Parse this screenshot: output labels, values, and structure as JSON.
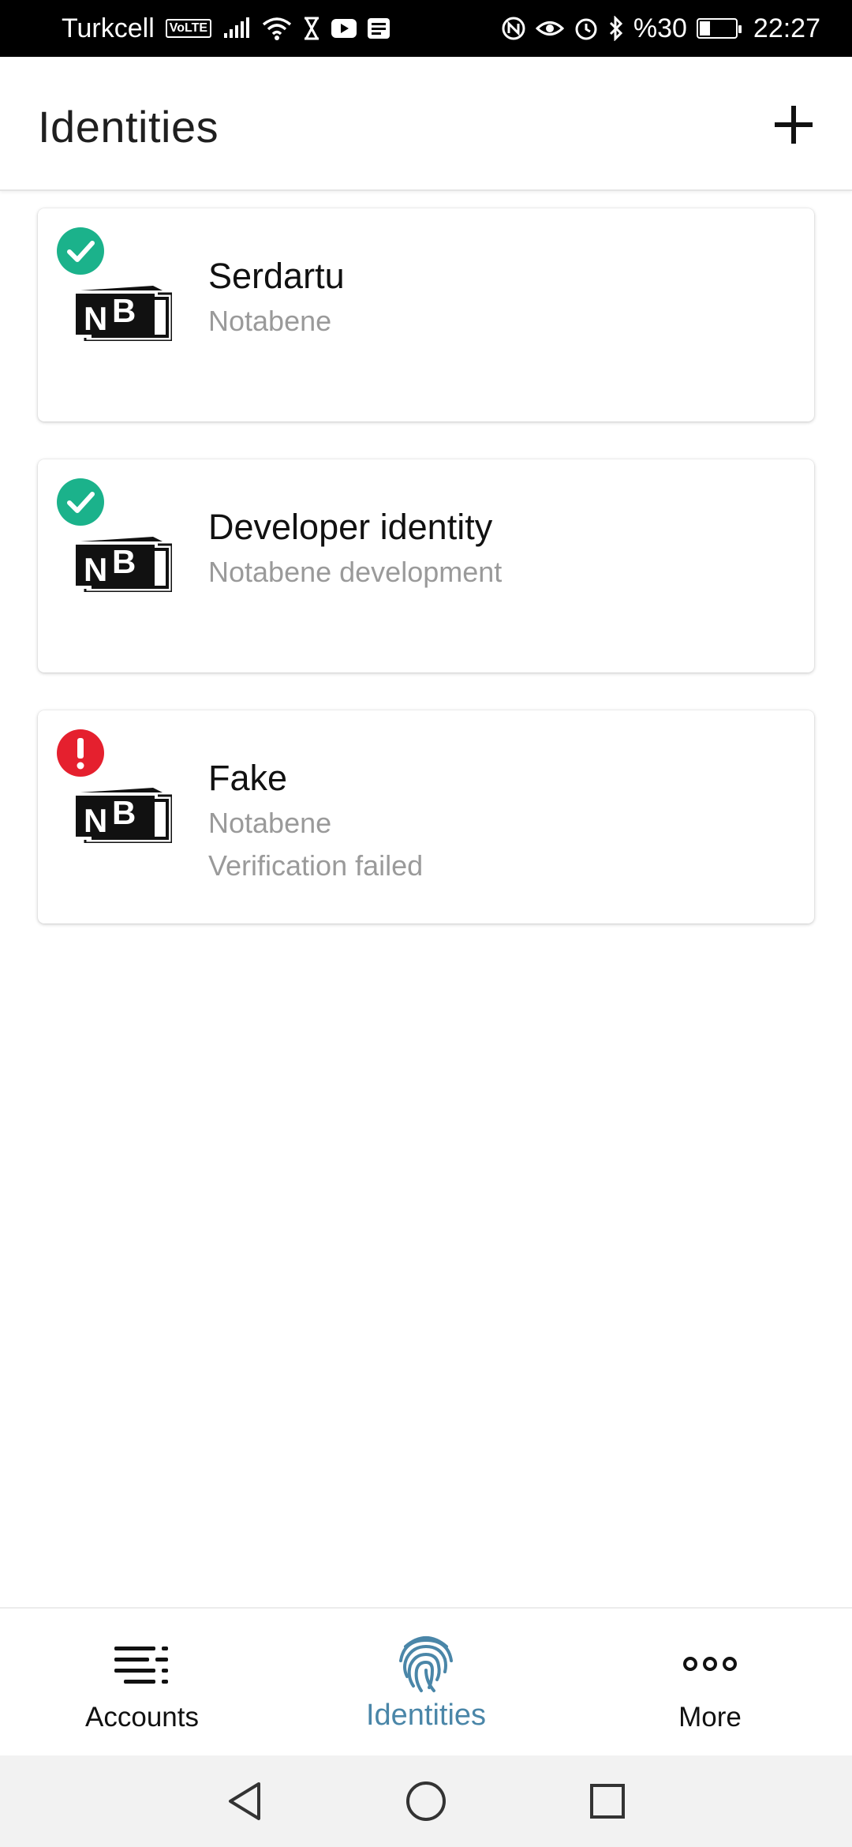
{
  "status_bar": {
    "carrier": "Turkcell",
    "volte": "VoLTE",
    "battery_text": "%30",
    "battery_level": 0.3,
    "time": "22:27"
  },
  "app_bar": {
    "title": "Identities",
    "add_icon": "plus-icon"
  },
  "identities": [
    {
      "name": "Serdartu",
      "issuer": "Notabene",
      "status": "verified",
      "badge_color": "#1bb28b",
      "note": ""
    },
    {
      "name": "Developer identity",
      "issuer": "Notabene development",
      "status": "verified",
      "badge_color": "#1bb28b",
      "note": ""
    },
    {
      "name": "Fake",
      "issuer": "Notabene",
      "status": "failed",
      "badge_color": "#e5202e",
      "note": "Verification failed"
    }
  ],
  "bottom_nav": {
    "items": [
      {
        "label": "Accounts",
        "icon": "list-icon",
        "active": false
      },
      {
        "label": "Identities",
        "icon": "fingerprint-icon",
        "active": true
      },
      {
        "label": "More",
        "icon": "more-dots-icon",
        "active": false
      }
    ],
    "active_color": "#4a86a8"
  },
  "system_nav": {
    "back_icon": "back-triangle-icon",
    "home_icon": "home-circle-icon",
    "recents_icon": "recents-square-icon"
  }
}
